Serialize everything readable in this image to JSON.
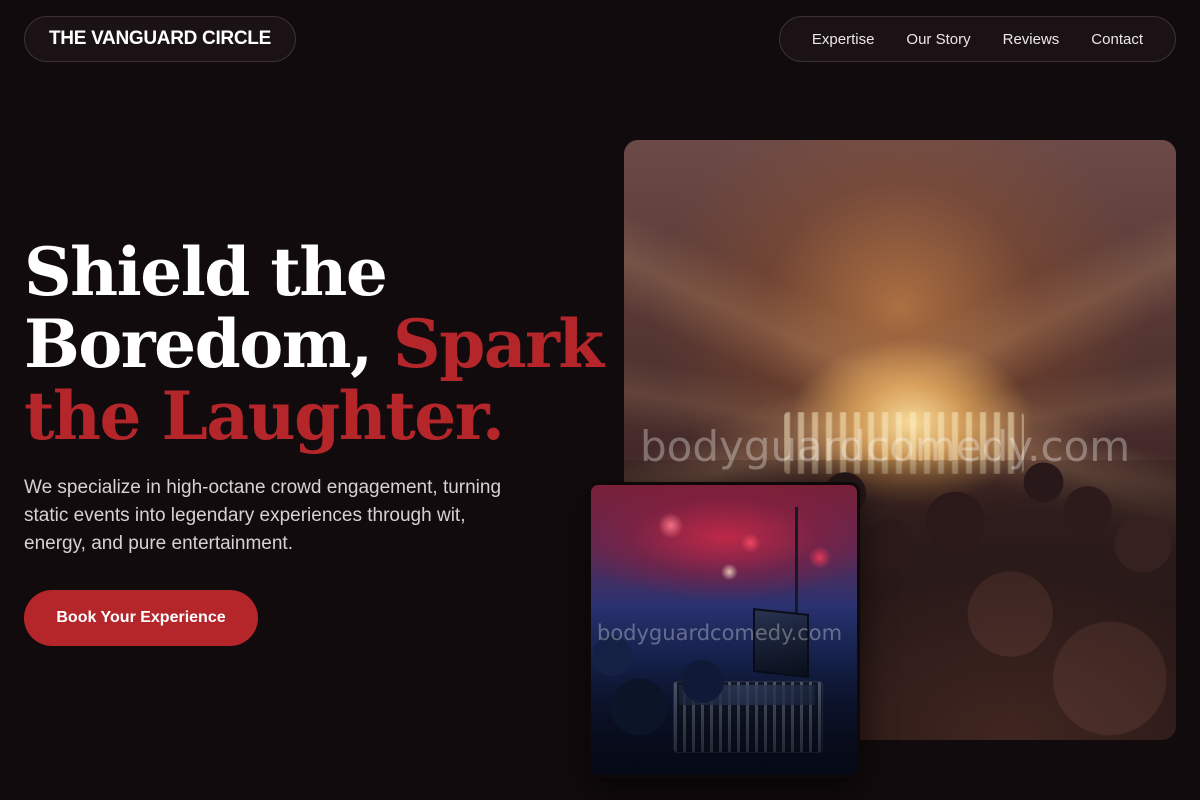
{
  "header": {
    "brand": "THE VANGUARD CIRCLE",
    "nav": [
      "Expertise",
      "Our Story",
      "Reviews",
      "Contact"
    ]
  },
  "hero": {
    "title_line_1": "Shield the",
    "title_line_2": "Boredom, ",
    "title_accent": "Spark the Laughter.",
    "subtitle": "We specialize in high-octane crowd engagement, turning static events into legendary experiences through wit, energy, and pure entertainment.",
    "cta_label": "Book Your Experience"
  },
  "images": {
    "main_watermark": "bodyguardcomedy.com",
    "secondary_watermark": "bodyguardcomedy.com"
  },
  "colors": {
    "background": "#120b0d",
    "accent": "#b4262a",
    "text": "#ffffff"
  }
}
